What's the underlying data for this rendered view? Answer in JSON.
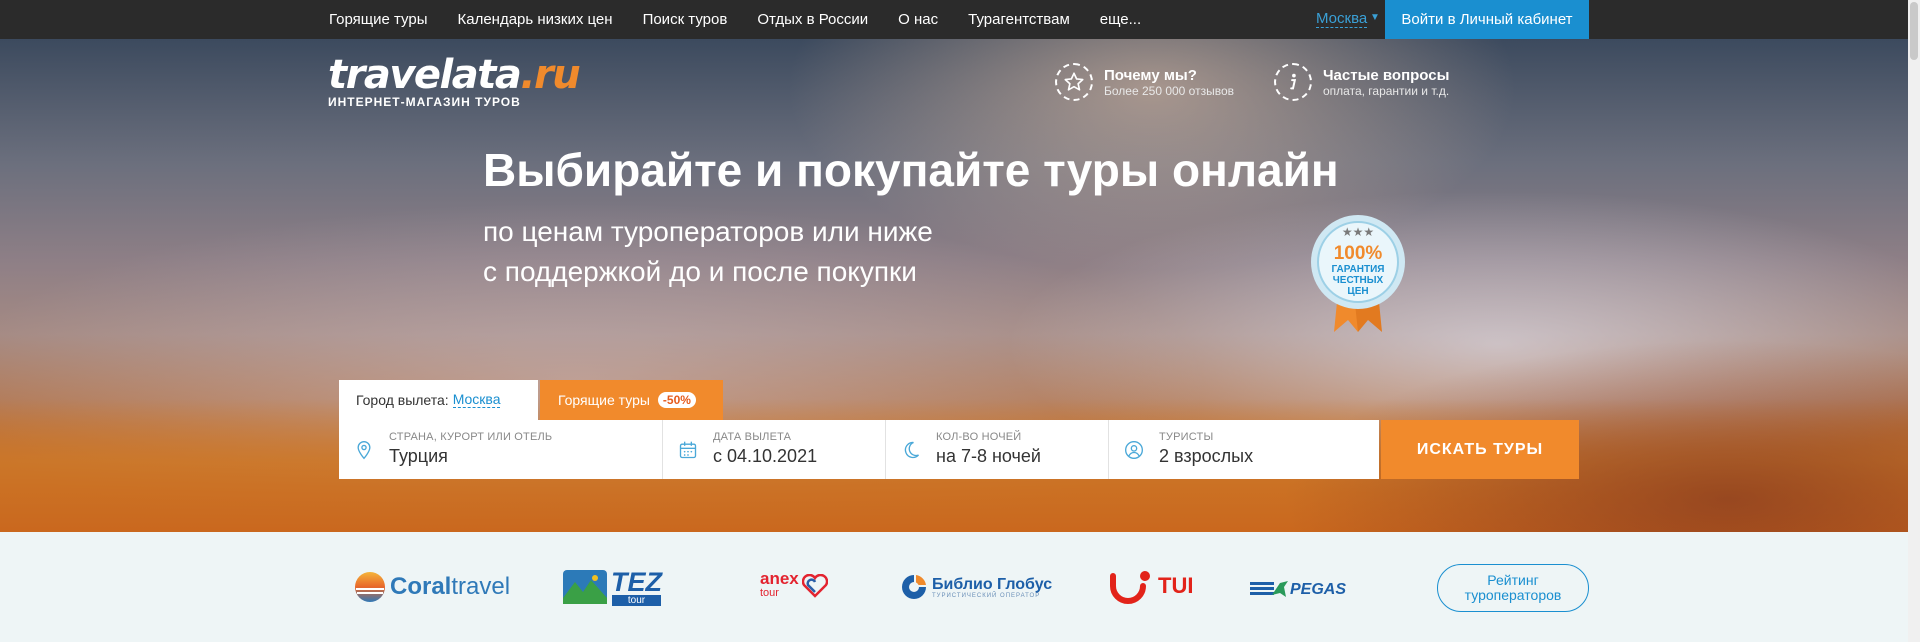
{
  "nav": {
    "links": [
      "Горящие туры",
      "Календарь низких цен",
      "Поиск туров",
      "Отдых в России",
      "О нас",
      "Турагентствам",
      "еще..."
    ],
    "city": "Москва",
    "login": "Войти в Личный кабинет"
  },
  "logo": {
    "word": "travelata",
    "ru": ".ru",
    "tagline": "ИНТЕРНЕТ-МАГАЗИН ТУРОВ"
  },
  "why": {
    "title": "Почему мы?",
    "subtitle": "Более 250 000 отзывов"
  },
  "faq": {
    "title": "Частые вопросы",
    "subtitle": "оплата, гарантии и т.д."
  },
  "hero": {
    "headline": "Выбирайте и покупайте туры онлайн",
    "sub1": "по ценам туроператоров или ниже",
    "sub2": "с поддержкой до и после покупки"
  },
  "badge": {
    "percent": "100%",
    "line1": "ГАРАНТИЯ",
    "line2": "ЧЕСТНЫХ",
    "line3": "ЦЕН"
  },
  "search": {
    "city_label": "Город вылета:",
    "city_value": "Москва",
    "hot_tab": "Горящие туры",
    "hot_discount": "-50%",
    "destination_label": "СТРАНА, КУРОРТ ИЛИ ОТЕЛЬ",
    "destination_value": "Турция",
    "date_label": "ДАТА ВЫЛЕТА",
    "date_value": "с 04.10.2021",
    "nights_label": "КОЛ-ВО НОЧЕЙ",
    "nights_value": "на 7-8 ночей",
    "tourists_label": "ТУРИСТЫ",
    "tourists_value": "2 взрослых",
    "button": "ИСКАТЬ ТУРЫ"
  },
  "partners": {
    "coral_a": "Coral",
    "coral_b": "travel",
    "tez": "TEZ",
    "tez_sub": "tour",
    "anex": "anex",
    "anex_sub": "tour",
    "biblio": "Библио Глобус",
    "biblio_sub": "ТУРИСТИЧЕСКИЙ ОПЕРАТОР",
    "tui": "TUI",
    "pegas": "PEGAS",
    "rating_line1": "Рейтинг",
    "rating_line2": "туроператоров"
  },
  "colors": {
    "accent_orange": "#f18a2c",
    "accent_blue": "#1a8fd0",
    "nav_bg": "#2b2b2b"
  }
}
